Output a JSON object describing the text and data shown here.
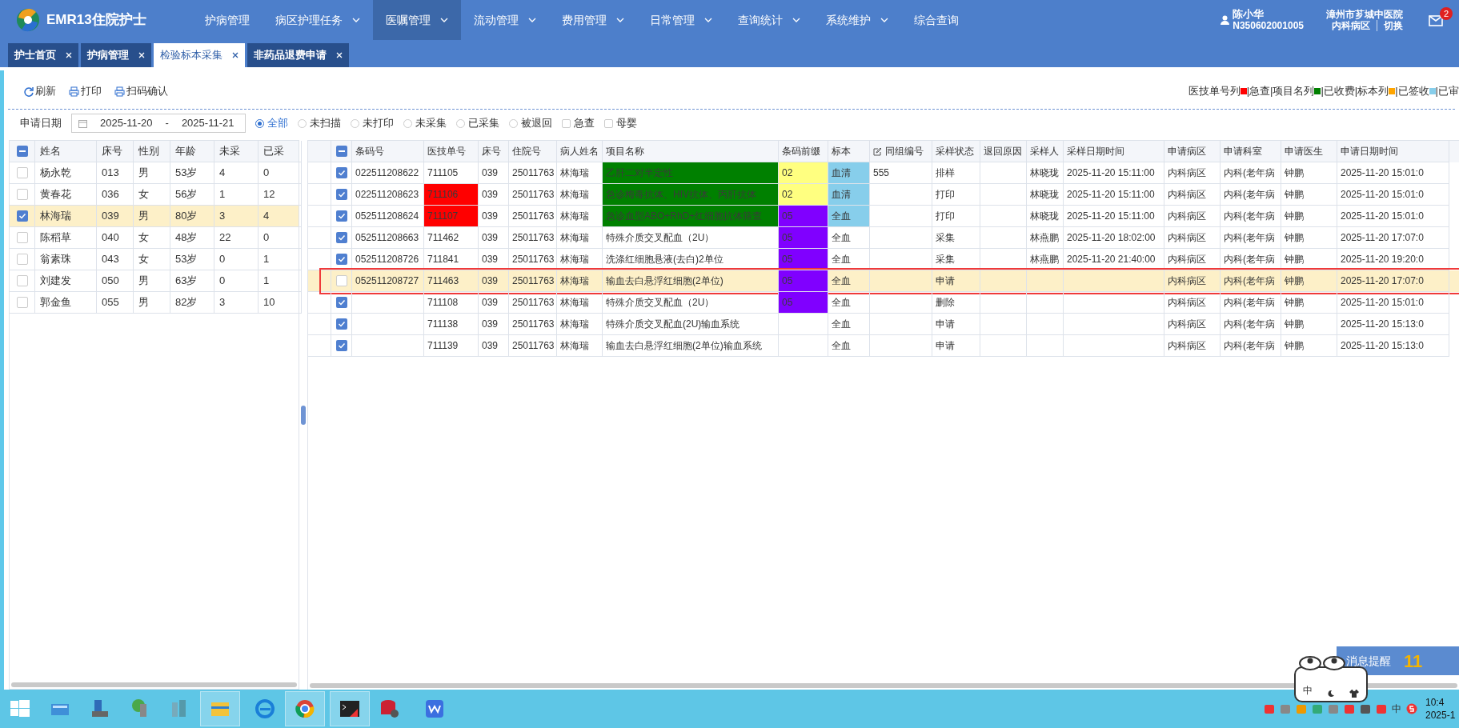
{
  "app": {
    "title": "EMR13住院护士"
  },
  "menu": [
    {
      "label": "护病管理",
      "dropdown": false,
      "selected": false
    },
    {
      "label": "病区护理任务",
      "dropdown": true,
      "selected": false
    },
    {
      "label": "医嘱管理",
      "dropdown": true,
      "selected": true
    },
    {
      "label": "流动管理",
      "dropdown": true,
      "selected": false
    },
    {
      "label": "费用管理",
      "dropdown": true,
      "selected": false
    },
    {
      "label": "日常管理",
      "dropdown": true,
      "selected": false
    },
    {
      "label": "查询统计",
      "dropdown": true,
      "selected": false
    },
    {
      "label": "系统维护",
      "dropdown": true,
      "selected": false
    },
    {
      "label": "综合查询",
      "dropdown": false,
      "selected": false
    }
  ],
  "user": {
    "name": "陈小华",
    "id": "N350602001005",
    "hospital": "漳州市芗城中医院",
    "ward": "内科病区",
    "switch": "切换",
    "mail_badge": "2"
  },
  "tabs": [
    {
      "label": "护士首页",
      "selected": false
    },
    {
      "label": "护病管理",
      "selected": false
    },
    {
      "label": "检验标本采集",
      "selected": true
    },
    {
      "label": "非药品退费申请",
      "selected": false
    }
  ],
  "toolbar": [
    {
      "label": "刷新",
      "kind": "refresh"
    },
    {
      "label": "打印",
      "kind": "print"
    },
    {
      "label": "扫码确认",
      "kind": "print"
    }
  ],
  "legend": [
    {
      "kind": "text",
      "text": "医技单号列"
    },
    {
      "kind": "swatch",
      "color": "#ff0000"
    },
    {
      "kind": "text",
      "text": "|急查|项目名列"
    },
    {
      "kind": "swatch",
      "color": "#008000"
    },
    {
      "kind": "text",
      "text": "|已收费|标本列"
    },
    {
      "kind": "swatch",
      "color": "#ffa500"
    },
    {
      "kind": "text",
      "text": "|已签收"
    },
    {
      "kind": "swatch",
      "color": "#87ceeb"
    },
    {
      "kind": "text",
      "text": "|已审"
    }
  ],
  "filter": {
    "label": "申请日期",
    "date_from": "2025-11-20",
    "separator": "-",
    "date_to": "2025-11-21",
    "radios": [
      {
        "label": "全部",
        "selected": true
      },
      {
        "label": "未扫描",
        "selected": false
      },
      {
        "label": "未打印",
        "selected": false
      },
      {
        "label": "未采集",
        "selected": false
      },
      {
        "label": "已采集",
        "selected": false
      },
      {
        "label": "被退回",
        "selected": false
      }
    ],
    "checks": [
      {
        "label": "急查",
        "checked": false
      },
      {
        "label": "母婴",
        "checked": false
      }
    ]
  },
  "patients": {
    "select_all_partial": true,
    "columns": [
      "姓名",
      "床号",
      "性别",
      "年龄",
      "未采",
      "已采"
    ],
    "rows": [
      {
        "checked": false,
        "selected": false,
        "cells": [
          "杨永乾",
          "013",
          "男",
          "53岁",
          "4",
          "0"
        ]
      },
      {
        "checked": false,
        "selected": false,
        "cells": [
          "黄春花",
          "036",
          "女",
          "56岁",
          "1",
          "12"
        ]
      },
      {
        "checked": true,
        "selected": true,
        "cells": [
          "林海瑞",
          "039",
          "男",
          "80岁",
          "3",
          "4"
        ]
      },
      {
        "checked": false,
        "selected": false,
        "cells": [
          "陈稻草",
          "040",
          "女",
          "48岁",
          "22",
          "0"
        ]
      },
      {
        "checked": false,
        "selected": false,
        "cells": [
          "翁素珠",
          "043",
          "女",
          "53岁",
          "0",
          "1"
        ]
      },
      {
        "checked": false,
        "selected": false,
        "cells": [
          "刘建发",
          "050",
          "男",
          "63岁",
          "0",
          "1"
        ]
      },
      {
        "checked": false,
        "selected": false,
        "cells": [
          "郭金鱼",
          "055",
          "男",
          "82岁",
          "3",
          "10"
        ]
      }
    ]
  },
  "orders": {
    "select_all_partial": true,
    "columns": [
      {
        "label": "条码号",
        "editable": false
      },
      {
        "label": "医技单号",
        "editable": false
      },
      {
        "label": "床号",
        "editable": false
      },
      {
        "label": "住院号",
        "editable": false
      },
      {
        "label": "病人姓名",
        "editable": false
      },
      {
        "label": "项目名称",
        "editable": false
      },
      {
        "label": "条码前缀",
        "editable": false
      },
      {
        "label": "标本",
        "editable": false
      },
      {
        "label": "同组编号",
        "editable": true
      },
      {
        "label": "采样状态",
        "editable": false
      },
      {
        "label": "退回原因",
        "editable": false
      },
      {
        "label": "采样人",
        "editable": false
      },
      {
        "label": "采样日期时间",
        "editable": false
      },
      {
        "label": "申请病区",
        "editable": false
      },
      {
        "label": "申请科室",
        "editable": false
      },
      {
        "label": "申请医生",
        "editable": false
      },
      {
        "label": "申请日期时间",
        "editable": false
      }
    ],
    "rows": [
      {
        "checked": true,
        "selected": false,
        "outlined": false,
        "cells": [
          {
            "text": "022511208622"
          },
          {
            "text": "711105"
          },
          {
            "text": "039"
          },
          {
            "text": "25011763"
          },
          {
            "text": "林海瑞"
          },
          {
            "text": "乙肝二对半定性",
            "color": "#008000"
          },
          {
            "text": "02",
            "color": "#ffff80"
          },
          {
            "text": "血清",
            "color": "#87ceeb"
          },
          {
            "text": "555"
          },
          {
            "text": "排样"
          },
          {},
          {
            "text": "林晓珑"
          },
          {
            "text": "2025-11-20 15:11:00"
          },
          {
            "text": "内科病区"
          },
          {
            "text": "内科(老年病"
          },
          {
            "text": "钟鹏"
          },
          {
            "text": "2025-11-20 15:01:0"
          }
        ]
      },
      {
        "checked": true,
        "selected": false,
        "outlined": false,
        "cells": [
          {
            "text": "022511208623"
          },
          {
            "text": "711106",
            "color": "#ff0000"
          },
          {
            "text": "039"
          },
          {
            "text": "25011763"
          },
          {
            "text": "林海瑞"
          },
          {
            "text": "急诊梅毒抗体、HIV抗体、丙肝抗体",
            "color": "#008000"
          },
          {
            "text": "02",
            "color": "#ffff80"
          },
          {
            "text": "血清",
            "color": "#87ceeb"
          },
          {},
          {
            "text": "打印"
          },
          {},
          {
            "text": "林晓珑"
          },
          {
            "text": "2025-11-20 15:11:00"
          },
          {
            "text": "内科病区"
          },
          {
            "text": "内科(老年病"
          },
          {
            "text": "钟鹏"
          },
          {
            "text": "2025-11-20 15:01:0"
          }
        ]
      },
      {
        "checked": true,
        "selected": false,
        "outlined": false,
        "cells": [
          {
            "text": "052511208624"
          },
          {
            "text": "711107",
            "color": "#ff0000"
          },
          {
            "text": "039"
          },
          {
            "text": "25011763"
          },
          {
            "text": "林海瑞"
          },
          {
            "text": "急诊血型ABO+RhD+红细胞抗体筛查",
            "color": "#008000"
          },
          {
            "text": "05",
            "color": "#8000ff"
          },
          {
            "text": "全血",
            "color": "#87ceeb"
          },
          {},
          {
            "text": "打印"
          },
          {},
          {
            "text": "林晓珑"
          },
          {
            "text": "2025-11-20 15:11:00"
          },
          {
            "text": "内科病区"
          },
          {
            "text": "内科(老年病"
          },
          {
            "text": "钟鹏"
          },
          {
            "text": "2025-11-20 15:01:0"
          }
        ]
      },
      {
        "checked": true,
        "selected": false,
        "outlined": false,
        "cells": [
          {
            "text": "052511208663"
          },
          {
            "text": "711462"
          },
          {
            "text": "039"
          },
          {
            "text": "25011763"
          },
          {
            "text": "林海瑞"
          },
          {
            "text": "特殊介质交叉配血（2U）"
          },
          {
            "text": "05",
            "color": "#8000ff"
          },
          {
            "text": "全血"
          },
          {},
          {
            "text": "采集"
          },
          {},
          {
            "text": "林燕鹏"
          },
          {
            "text": "2025-11-20 18:02:00"
          },
          {
            "text": "内科病区"
          },
          {
            "text": "内科(老年病"
          },
          {
            "text": "钟鹏"
          },
          {
            "text": "2025-11-20 17:07:0"
          }
        ]
      },
      {
        "checked": true,
        "selected": false,
        "outlined": false,
        "cells": [
          {
            "text": "052511208726"
          },
          {
            "text": "711841"
          },
          {
            "text": "039"
          },
          {
            "text": "25011763"
          },
          {
            "text": "林海瑞"
          },
          {
            "text": "洗涤红细胞悬液(去白)2单位"
          },
          {
            "text": "05",
            "color": "#8000ff"
          },
          {
            "text": "全血"
          },
          {},
          {
            "text": "采集"
          },
          {},
          {
            "text": "林燕鹏"
          },
          {
            "text": "2025-11-20 21:40:00"
          },
          {
            "text": "内科病区"
          },
          {
            "text": "内科(老年病"
          },
          {
            "text": "钟鹏"
          },
          {
            "text": "2025-11-20 19:20:0"
          }
        ]
      },
      {
        "checked": false,
        "selected": true,
        "outlined": true,
        "cells": [
          {
            "text": "052511208727"
          },
          {
            "text": "711463"
          },
          {
            "text": "039"
          },
          {
            "text": "25011763"
          },
          {
            "text": "林海瑞"
          },
          {
            "text": "输血去白悬浮红细胞(2单位)"
          },
          {
            "text": "05",
            "color": "#8000ff"
          },
          {
            "text": "全血"
          },
          {},
          {
            "text": "申请"
          },
          {},
          {},
          {},
          {
            "text": "内科病区"
          },
          {
            "text": "内科(老年病"
          },
          {
            "text": "钟鹏"
          },
          {
            "text": "2025-11-20 17:07:0"
          }
        ]
      },
      {
        "checked": true,
        "selected": false,
        "outlined": false,
        "cells": [
          {},
          {
            "text": "711108"
          },
          {
            "text": "039"
          },
          {
            "text": "25011763"
          },
          {
            "text": "林海瑞"
          },
          {
            "text": "特殊介质交叉配血（2U）"
          },
          {
            "text": "05",
            "color": "#8000ff"
          },
          {
            "text": "全血"
          },
          {},
          {
            "text": "删除"
          },
          {},
          {},
          {},
          {
            "text": "内科病区"
          },
          {
            "text": "内科(老年病"
          },
          {
            "text": "钟鹏"
          },
          {
            "text": "2025-11-20 15:01:0"
          }
        ]
      },
      {
        "checked": true,
        "selected": false,
        "outlined": false,
        "cells": [
          {},
          {
            "text": "711138"
          },
          {
            "text": "039"
          },
          {
            "text": "25011763"
          },
          {
            "text": "林海瑞"
          },
          {
            "text": "特殊介质交叉配血(2U)输血系统"
          },
          {},
          {
            "text": "全血"
          },
          {},
          {
            "text": "申请"
          },
          {},
          {},
          {},
          {
            "text": "内科病区"
          },
          {
            "text": "内科(老年病"
          },
          {
            "text": "钟鹏"
          },
          {
            "text": "2025-11-20 15:13:0"
          }
        ]
      },
      {
        "checked": true,
        "selected": false,
        "outlined": false,
        "cells": [
          {},
          {
            "text": "711139"
          },
          {
            "text": "039"
          },
          {
            "text": "25011763"
          },
          {
            "text": "林海瑞"
          },
          {
            "text": "输血去白悬浮红细胞(2单位)输血系统"
          },
          {},
          {
            "text": "全血"
          },
          {},
          {
            "text": "申请"
          },
          {},
          {},
          {},
          {
            "text": "内科病区"
          },
          {
            "text": "内科(老年病"
          },
          {
            "text": "钟鹏"
          },
          {
            "text": "2025-11-20 15:13:0"
          }
        ]
      }
    ]
  },
  "notice": {
    "label": "消息提醒",
    "count": "11"
  },
  "ime": {
    "label": "中"
  },
  "taskbar": {
    "apps": [
      {
        "kind": "start"
      },
      {
        "kind": "folder"
      },
      {
        "kind": "computer"
      },
      {
        "kind": "shield"
      },
      {
        "kind": "network"
      },
      {
        "kind": "files"
      },
      {
        "kind": "ie"
      },
      {
        "kind": "chrome"
      },
      {
        "kind": "terminal"
      },
      {
        "kind": "database"
      },
      {
        "kind": "office"
      }
    ],
    "tray_ime": "中",
    "time": "10:4",
    "date": "2025-1"
  }
}
